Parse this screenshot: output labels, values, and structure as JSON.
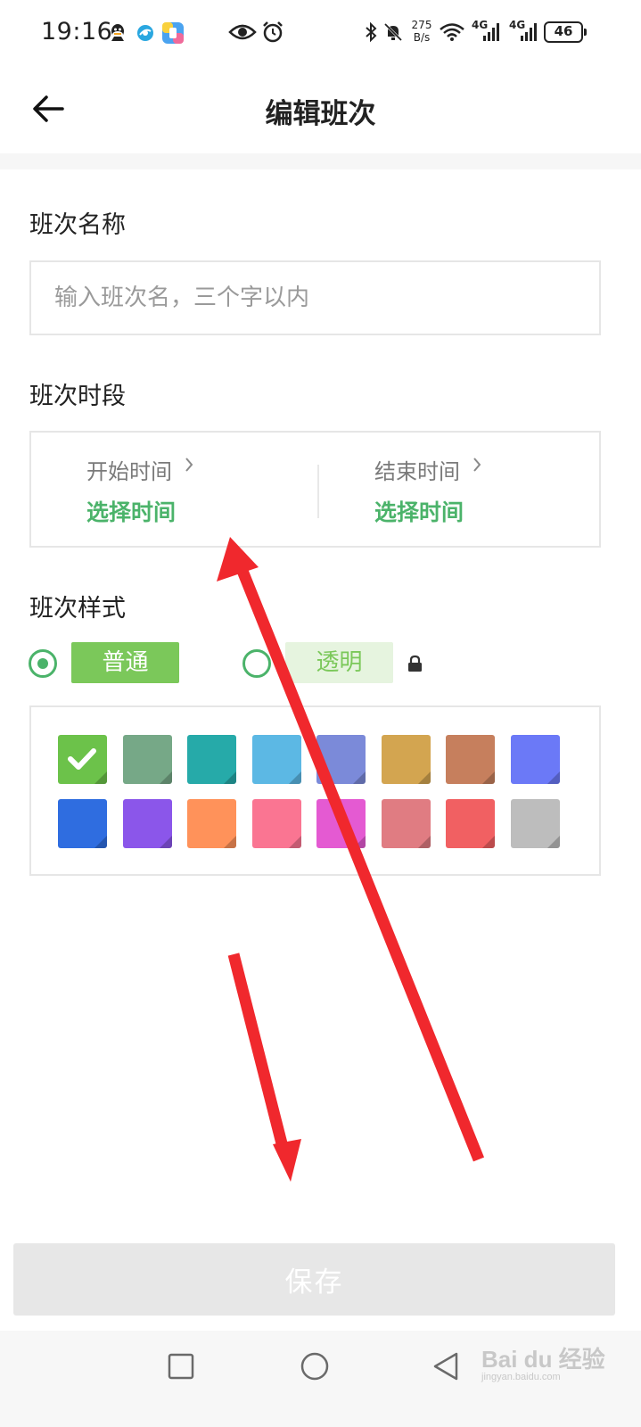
{
  "status_bar": {
    "time": "19:16",
    "net_speed_value": "275",
    "net_speed_unit": "B/s",
    "signal_1_label": "4G",
    "signal_2_label": "4G",
    "battery": "46",
    "icons": [
      "qq-icon",
      "browser-icon",
      "app-icon",
      "eye-icon",
      "alarm-icon",
      "bluetooth-icon",
      "mute-bell-icon",
      "wifi-icon",
      "signal-icon",
      "signal-icon",
      "battery-icon"
    ]
  },
  "header": {
    "title": "编辑班次",
    "back_icon": "back-arrow-icon"
  },
  "form": {
    "name_section": {
      "label": "班次名称",
      "input_value": "",
      "input_placeholder": "输入班次名，三个字以内"
    },
    "time_section": {
      "label": "班次时段",
      "start": {
        "label": "开始时间",
        "value": "选择时间"
      },
      "end": {
        "label": "结束时间",
        "value": "选择时间"
      }
    },
    "style_section": {
      "label": "班次样式",
      "options": [
        {
          "label": "普通",
          "selected": true
        },
        {
          "label": "透明",
          "selected": false,
          "locked": true
        }
      ]
    },
    "palette": {
      "selected_index": 0,
      "colors": [
        "#6cc24a",
        "#76a887",
        "#26aaa9",
        "#5cb8e4",
        "#7b8ad9",
        "#d3a550",
        "#c67f5d",
        "#6b79f7",
        "#2f6de0",
        "#8b56ea",
        "#ff925a",
        "#fa7592",
        "#e45ad2",
        "#e07c82",
        "#f16062",
        "#bdbdbd"
      ]
    }
  },
  "footer": {
    "save_label": "保存"
  },
  "accent_color": "#4bb36a",
  "nav_bar": {
    "buttons": [
      "recent-apps-icon",
      "home-icon",
      "back-triangle-icon"
    ]
  },
  "watermark": {
    "text": "Bai du 经验",
    "sub": "jingyan.baidu.com"
  }
}
